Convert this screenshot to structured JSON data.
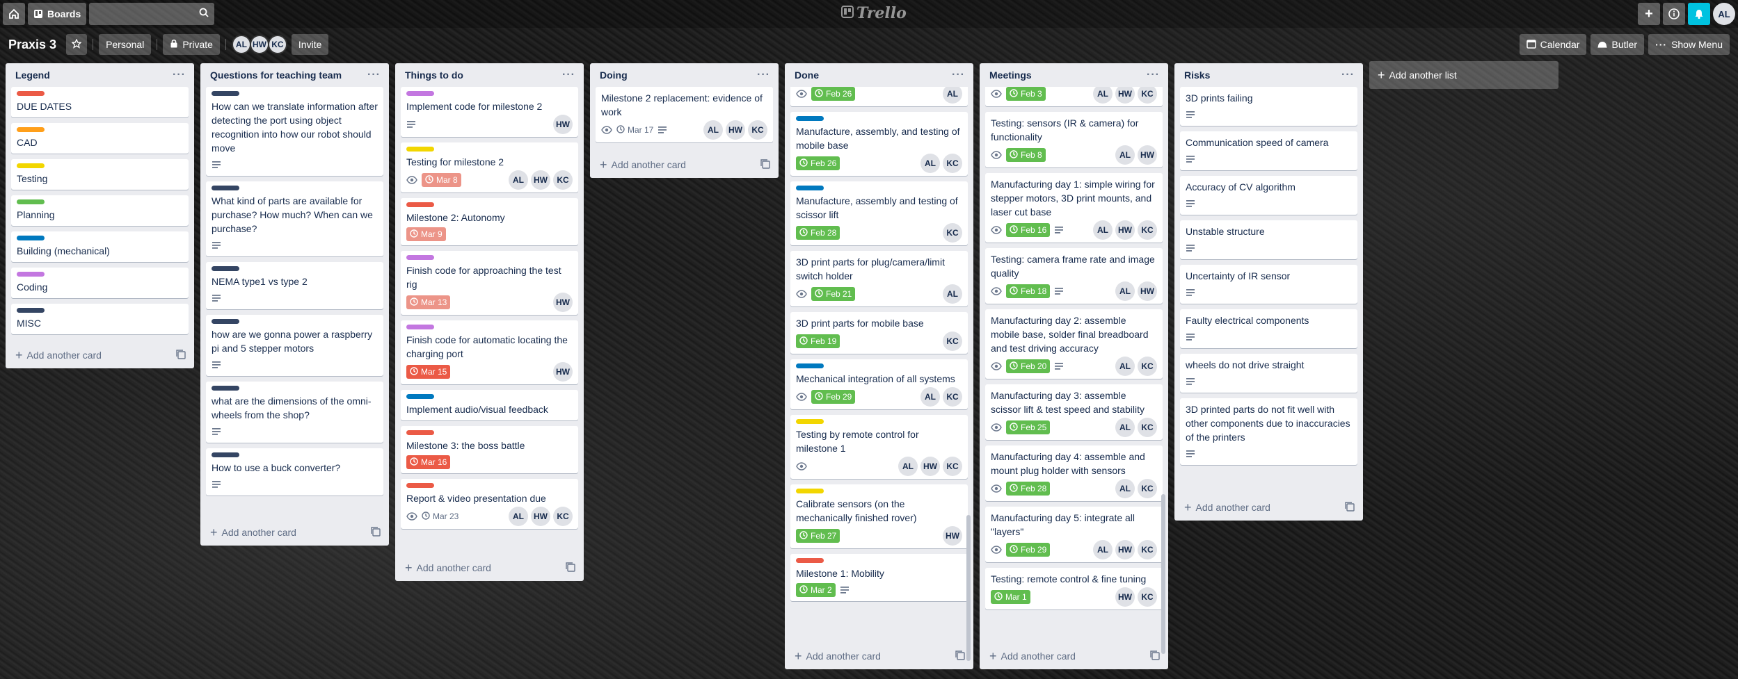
{
  "header": {
    "boards_label": "Boards",
    "logo": "Trello",
    "user_initials": "AL"
  },
  "board": {
    "title": "Praxis 3",
    "team_label": "Personal",
    "visibility_label": "Private",
    "members": [
      "AL",
      "HW",
      "KC"
    ],
    "invite_label": "Invite",
    "calendar_label": "Calendar",
    "butler_label": "Butler",
    "show_menu_label": "Show Menu",
    "add_list_label": "Add another list",
    "add_card_label": "Add another card"
  },
  "colors": {
    "red": "#eb5a46",
    "orange": "#ff9f1a",
    "yellow": "#f2d600",
    "green": "#61bd4f",
    "blue": "#0079bf",
    "purple": "#c377e0",
    "navy": "#344563"
  },
  "lists": [
    {
      "title": "Legend",
      "cards": [
        {
          "label": "red",
          "title": "DUE DATES"
        },
        {
          "label": "orange",
          "title": "CAD"
        },
        {
          "label": "yellow",
          "title": "Testing"
        },
        {
          "label": "green",
          "title": "Planning"
        },
        {
          "label": "blue",
          "title": "Building (mechanical)"
        },
        {
          "label": "purple",
          "title": "Coding"
        },
        {
          "label": "navy",
          "title": "MISC"
        }
      ]
    },
    {
      "title": "Questions for teaching team",
      "cards": [
        {
          "label": "navy",
          "title": "How can we translate information after detecting the port using object recognition into how our robot should move",
          "desc": true
        },
        {
          "label": "navy",
          "title": "What kind of parts are available for purchase? How much? When can we purchase?",
          "desc": true
        },
        {
          "label": "navy",
          "title": "NEMA type1 vs type 2",
          "desc": true
        },
        {
          "label": "navy",
          "title": "how are we gonna power a raspberry pi and 5 stepper motors",
          "desc": true
        },
        {
          "label": "navy",
          "title": "what are the dimensions of the omni-wheels from the shop?",
          "desc": true
        },
        {
          "label": "navy",
          "title": "How to use a buck converter?",
          "desc": true
        }
      ]
    },
    {
      "title": "Things to do",
      "cards": [
        {
          "label": "purple",
          "title": "Implement code for milestone 2",
          "desc": true,
          "members": [
            "HW"
          ]
        },
        {
          "label": "yellow",
          "title": "Testing for milestone 2",
          "watch": true,
          "due": "Mar 8",
          "due_style": "pink",
          "members": [
            "AL",
            "HW",
            "KC"
          ]
        },
        {
          "label": "red",
          "title": "Milestone 2: Autonomy",
          "due": "Mar 9",
          "due_style": "pink"
        },
        {
          "label": "purple",
          "title": "Finish code for approaching the test rig",
          "due": "Mar 13",
          "due_style": "pink",
          "members": [
            "HW"
          ]
        },
        {
          "label": "purple",
          "title": "Finish code for automatic locating the charging port",
          "due": "Mar 15",
          "due_style": "red",
          "members": [
            "HW"
          ]
        },
        {
          "label": "blue",
          "title": "Implement audio/visual feedback"
        },
        {
          "label": "red",
          "title": "Milestone 3: the boss battle",
          "due": "Mar 16",
          "due_style": "red"
        },
        {
          "label": "red",
          "title": "Report & video presentation due",
          "watch": true,
          "due": "Mar 23",
          "due_style": "plain",
          "members": [
            "AL",
            "HW",
            "KC"
          ]
        }
      ]
    },
    {
      "title": "Doing",
      "cards": [
        {
          "title": "Milestone 2 replacement: evidence of work",
          "watch": true,
          "due": "Mar 17",
          "due_style": "plain",
          "desc": true,
          "members": [
            "AL",
            "HW",
            "KC"
          ]
        }
      ]
    },
    {
      "title": "Done",
      "cards": [
        {
          "title": "",
          "watch": true,
          "due": "Feb 26",
          "due_style": "green",
          "members": [
            "AL"
          ],
          "partial": true
        },
        {
          "label": "blue",
          "title": "Manufacture, assembly, and testing of mobile base",
          "due": "Feb 26",
          "due_style": "green",
          "members": [
            "AL",
            "KC"
          ]
        },
        {
          "label": "blue",
          "title": "Manufacture, assembly and testing of scissor lift",
          "due": "Feb 28",
          "due_style": "green",
          "members": [
            "KC"
          ]
        },
        {
          "title": "3D print parts for plug/camera/limit switch holder",
          "watch": true,
          "due": "Feb 21",
          "due_style": "green",
          "members": [
            "AL"
          ]
        },
        {
          "title": "3D print parts for mobile base",
          "due": "Feb 19",
          "due_style": "green",
          "members": [
            "KC"
          ]
        },
        {
          "label": "blue",
          "title": "Mechanical integration of all systems",
          "watch": true,
          "due": "Feb 29",
          "due_style": "green",
          "members": [
            "AL",
            "KC"
          ]
        },
        {
          "label": "yellow",
          "title": "Testing by remote control for milestone 1",
          "watch": true,
          "members": [
            "AL",
            "HW",
            "KC"
          ]
        },
        {
          "label": "yellow",
          "title": "Calibrate sensors (on the mechanically finished rover)",
          "due": "Feb 27",
          "due_style": "green",
          "members": [
            "HW"
          ]
        },
        {
          "label": "red",
          "title": "Milestone 1: Mobility",
          "due": "Mar 2",
          "due_style": "green",
          "desc": true
        }
      ]
    },
    {
      "title": "Meetings",
      "cards": [
        {
          "title": "",
          "watch": true,
          "due": "Feb 3",
          "due_style": "green",
          "members": [
            "AL",
            "HW",
            "KC"
          ],
          "partial": true
        },
        {
          "title": "Testing: sensors (IR & camera) for functionality",
          "watch": true,
          "due": "Feb 8",
          "due_style": "green",
          "members": [
            "AL",
            "HW"
          ]
        },
        {
          "title": "Manufacturing day 1: simple wiring for stepper motors, 3D print mounts, and laser cut base",
          "watch": true,
          "due": "Feb 16",
          "due_style": "green",
          "desc": true,
          "members": [
            "AL",
            "HW",
            "KC"
          ]
        },
        {
          "title": "Testing: camera frame rate and image quality",
          "watch": true,
          "due": "Feb 18",
          "due_style": "green",
          "desc": true,
          "members": [
            "AL",
            "HW"
          ]
        },
        {
          "title": "Manufacturing day 2: assemble mobile base, solder final breadboard and test driving accuracy",
          "watch": true,
          "due": "Feb 20",
          "due_style": "green",
          "desc": true,
          "members": [
            "AL",
            "KC"
          ]
        },
        {
          "title": "Manufacturing day 3: assemble scissor lift & test speed and stability",
          "watch": true,
          "due": "Feb 25",
          "due_style": "green",
          "members": [
            "AL",
            "KC"
          ]
        },
        {
          "title": "Manufacturing day 4: assemble and mount plug holder with sensors",
          "watch": true,
          "due": "Feb 28",
          "due_style": "green",
          "members": [
            "AL",
            "KC"
          ]
        },
        {
          "title": "Manufacturing day 5: integrate all \"layers\"",
          "watch": true,
          "due": "Feb 29",
          "due_style": "green",
          "members": [
            "AL",
            "HW",
            "KC"
          ]
        },
        {
          "title": "Testing: remote control & fine tuning",
          "due": "Mar 1",
          "due_style": "green",
          "members": [
            "HW",
            "KC"
          ]
        }
      ]
    },
    {
      "title": "Risks",
      "cards": [
        {
          "title": "3D prints failing",
          "desc": true
        },
        {
          "title": "Communication speed of camera",
          "desc": true
        },
        {
          "title": "Accuracy of CV algorithm",
          "desc": true
        },
        {
          "title": "Unstable structure",
          "desc": true
        },
        {
          "title": "Uncertainty of IR sensor",
          "desc": true
        },
        {
          "title": "Faulty electrical components",
          "desc": true
        },
        {
          "title": "wheels do not drive straight",
          "desc": true
        },
        {
          "title": "3D printed parts do not fit well with other components due to inaccuracies of the printers",
          "desc": true
        }
      ]
    }
  ]
}
